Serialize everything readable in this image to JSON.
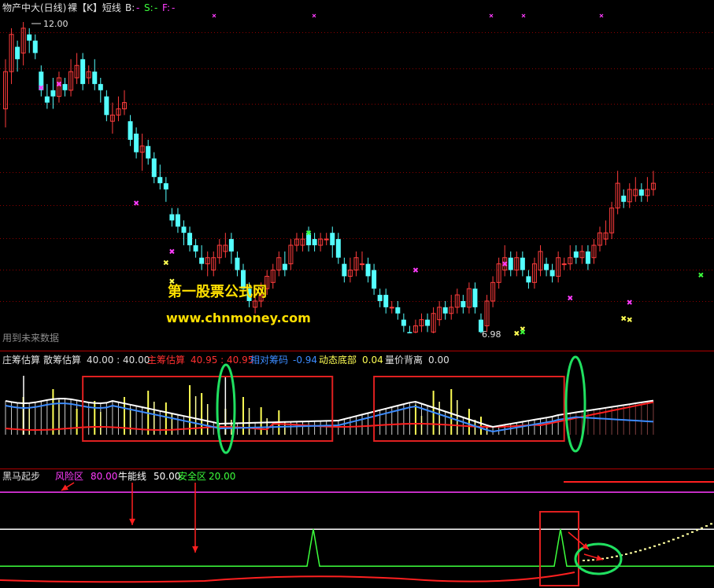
{
  "colors": {
    "up": "#ff3c3c",
    "down": "#54ffff",
    "grid": "#8b0000",
    "separator": "#b00000",
    "text": "#e0e0e0",
    "magenta": "#ff3cff",
    "green": "#3cff3c",
    "yellow": "#ffff54",
    "blue": "#3c8cff",
    "white": "#ffffff",
    "red": "#ff2020",
    "callout_ring": "#20e060",
    "box": "#e02020",
    "watermark": "#ffe000"
  },
  "main_panel": {
    "header": {
      "security": "物产中大(日线)",
      "mode": "裸【K】短线",
      "b_label": "B:",
      "b_value": "-",
      "s_label": "S:",
      "s_value": "-",
      "f_label": "F:",
      "f_value": "-"
    },
    "high_label": "12.00",
    "low_label": "6.98",
    "footer_note": "用到未来数据",
    "watermark_title": "第一股票公式网",
    "watermark_url": "www.chnmoney.com"
  },
  "panel2": {
    "title": "庄筹估算",
    "items": [
      {
        "label": "散筹估算",
        "value": "40.00 : 40.00",
        "color": "#e0e0e0"
      },
      {
        "label": "主筹估算",
        "value": "40.95 : 40.95",
        "color": "#ff3030"
      },
      {
        "label": "相对筹码",
        "value": "-0.94",
        "color": "#3c8cff"
      },
      {
        "label": "动态底部",
        "value": "0.04",
        "color": "#ffff54"
      },
      {
        "label": "量价背离",
        "value": "0.00",
        "color": "#e0e0e0"
      }
    ]
  },
  "panel3": {
    "title": "黑马起步",
    "items": [
      {
        "label": "风险区",
        "value": "80.00",
        "color": "#ff3cff"
      },
      {
        "label": "牛能线",
        "value": "50.00",
        "color": "#ffffff"
      },
      {
        "label": "安全区",
        "value": "20.00",
        "color": "#3cff3c"
      }
    ]
  },
  "chart_data": {
    "type": "candlestick",
    "price_range": [
      6.98,
      12.0
    ],
    "candles": [
      [
        10.6,
        11.2,
        11.4,
        10.3
      ],
      [
        11.2,
        11.8,
        11.9,
        11.0
      ],
      [
        11.6,
        11.4,
        11.7,
        11.2
      ],
      [
        11.5,
        11.9,
        12.0,
        11.3
      ],
      [
        11.8,
        11.7,
        11.9,
        11.5
      ],
      [
        11.7,
        11.5,
        11.8,
        11.4
      ],
      [
        11.2,
        10.9,
        11.3,
        10.8
      ],
      [
        10.8,
        10.7,
        11.0,
        10.6
      ],
      [
        10.9,
        10.8,
        11.1,
        10.6
      ],
      [
        10.8,
        11.1,
        11.2,
        10.7
      ],
      [
        11.0,
        10.9,
        11.1,
        10.8
      ],
      [
        10.9,
        11.2,
        11.4,
        10.8
      ],
      [
        11.1,
        11.3,
        11.5,
        11.0
      ],
      [
        11.4,
        11.0,
        11.5,
        10.9
      ],
      [
        11.1,
        11.2,
        11.3,
        11.0
      ],
      [
        11.2,
        11.0,
        11.4,
        10.9
      ],
      [
        11.0,
        10.9,
        11.1,
        10.7
      ],
      [
        10.8,
        10.5,
        10.9,
        10.4
      ],
      [
        10.4,
        10.5,
        10.7,
        10.2
      ],
      [
        10.5,
        10.6,
        10.8,
        10.4
      ],
      [
        10.6,
        10.7,
        10.9,
        10.5
      ],
      [
        10.4,
        10.1,
        10.5,
        10.0
      ],
      [
        10.2,
        9.9,
        10.3,
        9.8
      ],
      [
        9.9,
        10.0,
        10.2,
        9.6
      ],
      [
        10.0,
        9.8,
        10.1,
        9.7
      ],
      [
        9.8,
        9.5,
        9.9,
        9.4
      ],
      [
        9.5,
        9.4,
        9.7,
        9.3
      ],
      [
        9.4,
        9.3,
        9.5,
        9.1
      ],
      [
        8.9,
        8.8,
        9.0,
        8.7
      ],
      [
        8.9,
        8.7,
        9.0,
        8.6
      ],
      [
        8.7,
        8.6,
        8.8,
        8.4
      ],
      [
        8.6,
        8.4,
        8.7,
        8.3
      ],
      [
        8.4,
        8.3,
        8.5,
        8.2
      ],
      [
        8.2,
        8.1,
        8.4,
        8.0
      ],
      [
        8.1,
        8.2,
        8.3,
        7.9
      ],
      [
        8.0,
        8.2,
        8.3,
        7.9
      ],
      [
        8.2,
        8.4,
        8.5,
        8.1
      ],
      [
        8.3,
        8.4,
        8.6,
        8.2
      ],
      [
        8.5,
        8.3,
        8.6,
        8.1
      ],
      [
        8.2,
        8.0,
        8.3,
        7.9
      ],
      [
        8.0,
        7.7,
        8.1,
        7.6
      ],
      [
        7.7,
        7.5,
        7.8,
        7.4
      ],
      [
        7.4,
        7.5,
        7.7,
        7.3
      ],
      [
        7.5,
        7.6,
        7.8,
        7.4
      ],
      [
        7.7,
        7.9,
        8.0,
        7.6
      ],
      [
        7.8,
        8.0,
        8.1,
        7.7
      ],
      [
        8.0,
        8.2,
        8.3,
        7.9
      ],
      [
        8.1,
        8.0,
        8.3,
        7.9
      ],
      [
        8.1,
        8.4,
        8.5,
        8.0
      ],
      [
        8.4,
        8.5,
        8.6,
        8.3
      ],
      [
        8.4,
        8.5,
        8.6,
        8.3
      ],
      [
        8.6,
        8.4,
        8.7,
        8.3
      ],
      [
        8.5,
        8.4,
        8.6,
        8.3
      ],
      [
        8.4,
        8.5,
        8.6,
        8.3
      ],
      [
        8.5,
        8.5,
        8.6,
        8.4
      ],
      [
        8.6,
        8.4,
        8.7,
        8.2
      ],
      [
        8.5,
        8.2,
        8.6,
        8.1
      ],
      [
        8.1,
        7.9,
        8.2,
        7.8
      ],
      [
        7.9,
        8.0,
        8.2,
        7.8
      ],
      [
        8.0,
        8.2,
        8.3,
        7.9
      ],
      [
        8.1,
        8.1,
        8.3,
        8.0
      ],
      [
        8.1,
        7.9,
        8.2,
        7.8
      ],
      [
        8.0,
        7.7,
        8.1,
        7.6
      ],
      [
        7.6,
        7.5,
        7.7,
        7.4
      ],
      [
        7.6,
        7.4,
        7.7,
        7.3
      ],
      [
        7.4,
        7.4,
        7.5,
        7.3
      ],
      [
        7.4,
        7.3,
        7.5,
        7.2
      ],
      [
        7.2,
        7.1,
        7.3,
        7.0
      ],
      [
        7.0,
        6.98,
        7.1,
        6.98
      ],
      [
        7.0,
        7.1,
        7.2,
        6.98
      ],
      [
        7.1,
        7.2,
        7.3,
        7.0
      ],
      [
        7.2,
        7.1,
        7.3,
        7.0
      ],
      [
        7.0,
        7.3,
        7.4,
        6.98
      ],
      [
        7.2,
        7.4,
        7.5,
        7.1
      ],
      [
        7.4,
        7.3,
        7.5,
        7.2
      ],
      [
        7.3,
        7.4,
        7.6,
        7.2
      ],
      [
        7.4,
        7.6,
        7.7,
        7.3
      ],
      [
        7.5,
        7.4,
        7.6,
        7.3
      ],
      [
        7.4,
        7.7,
        7.8,
        7.3
      ],
      [
        7.7,
        7.4,
        7.8,
        7.3
      ],
      [
        7.2,
        7.0,
        7.3,
        6.98
      ],
      [
        7.1,
        7.5,
        7.6,
        7.0
      ],
      [
        7.5,
        7.8,
        7.9,
        7.4
      ],
      [
        7.8,
        8.1,
        8.2,
        7.7
      ],
      [
        8.0,
        8.2,
        8.4,
        7.9
      ],
      [
        8.2,
        8.0,
        8.3,
        7.9
      ],
      [
        8.0,
        8.2,
        8.3,
        7.9
      ],
      [
        8.2,
        8.0,
        8.3,
        7.9
      ],
      [
        7.9,
        7.8,
        8.0,
        7.7
      ],
      [
        7.8,
        8.1,
        8.2,
        7.7
      ],
      [
        8.0,
        8.3,
        8.4,
        7.9
      ],
      [
        8.1,
        8.0,
        8.2,
        7.9
      ],
      [
        8.0,
        7.9,
        8.1,
        7.8
      ],
      [
        7.9,
        8.2,
        8.3,
        7.8
      ],
      [
        8.1,
        8.1,
        8.2,
        8.0
      ],
      [
        8.1,
        8.2,
        8.4,
        8.0
      ],
      [
        8.3,
        8.2,
        8.4,
        8.1
      ],
      [
        8.2,
        8.3,
        8.4,
        8.1
      ],
      [
        8.3,
        8.1,
        8.4,
        8.0
      ],
      [
        8.2,
        8.4,
        8.5,
        8.1
      ],
      [
        8.4,
        8.6,
        8.7,
        8.3
      ],
      [
        8.5,
        8.6,
        8.8,
        8.4
      ],
      [
        8.6,
        9.0,
        9.1,
        8.5
      ],
      [
        9.0,
        9.4,
        9.6,
        8.9
      ],
      [
        9.2,
        9.1,
        9.3,
        9.0
      ],
      [
        9.1,
        9.3,
        9.4,
        9.0
      ],
      [
        9.2,
        9.3,
        9.5,
        9.1
      ],
      [
        9.3,
        9.2,
        9.4,
        9.1
      ],
      [
        9.2,
        9.3,
        9.5,
        9.1
      ],
      [
        9.3,
        9.4,
        9.6,
        9.2
      ]
    ],
    "lower_markers_magenta": [
      [
        6,
        10.94
      ],
      [
        9,
        11.0
      ],
      [
        22,
        9.08
      ],
      [
        28,
        8.3
      ],
      [
        69,
        8.0
      ],
      [
        84,
        8.1
      ],
      [
        95,
        7.55
      ],
      [
        105,
        7.48
      ]
    ],
    "lower_markers_yellow": [
      [
        27,
        8.12
      ],
      [
        28,
        7.82
      ],
      [
        86,
        6.98
      ],
      [
        87,
        7.05
      ],
      [
        104,
        7.22
      ],
      [
        105,
        7.2
      ]
    ],
    "green_markers": [
      [
        51,
        8.6
      ],
      [
        87,
        7.0
      ],
      [
        117,
        7.92
      ]
    ],
    "panel2_highlight_boxes": [
      [
        13,
        55
      ],
      [
        62,
        94
      ]
    ],
    "panel3_levels": {
      "risk": 80,
      "bull_line": 50,
      "safe": 20
    }
  }
}
